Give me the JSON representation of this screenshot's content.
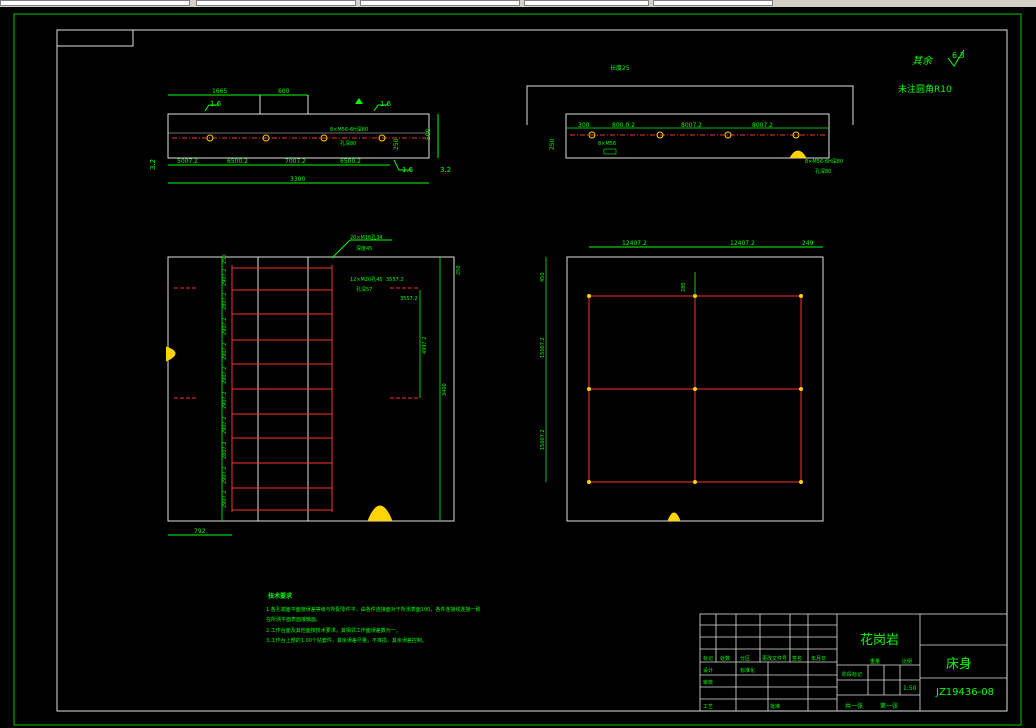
{
  "title_block": {
    "material": "花岗岩",
    "part_name": "床身",
    "drawing_number": "JZ19436-08",
    "scale": "1:50",
    "sheet_total": "共一张",
    "sheet_index": "第一张",
    "weight_label": "重量",
    "scale_label": "比例",
    "stage_label": "阶段标记",
    "process_label": "工艺",
    "approve_label": "批准",
    "design_label": "设计",
    "check_label": "审核",
    "standard_label": "标准化",
    "mark_label": "标记",
    "count_label": "处数",
    "zone_label": "分区",
    "change_doc_label": "更改文件号",
    "sign_label": "签名",
    "date_label": "年月日",
    "mark2_label": "标记"
  },
  "notes": {
    "heading": "技术要求",
    "lines": [
      "1.各孔端面平面度误差等级与所配零件平，由各件连接面对于所测表面100，各件连接线连接一致",
      "在所测平面表面接触面。",
      "2.工作台面及其他面按技术要求，其相邻工作面误差数为一。",
      "3.工作台上部的1.00个钻套件，其余误差尽量，不准损，其余误差控制。"
    ]
  },
  "roughness": {
    "label": "其余",
    "value": "6.3",
    "corner_note": "未注圆角R10"
  },
  "front_view": {
    "dims_top": [
      "1665",
      "600"
    ],
    "roughness_marks": [
      "1.6",
      "1.6"
    ],
    "hole_note": "8×M56-6H深80",
    "hole_note2": "孔深80",
    "dims_bottom": [
      "5007.2",
      "6500.2",
      "7007.2",
      "6500.2"
    ],
    "overall": "3300",
    "height": "500",
    "side_dim": "250",
    "rough_left": "3.2",
    "rough_right": "3.2",
    "rough_bottom": "1.6"
  },
  "side_view": {
    "top_note": "长度25",
    "dims": [
      "300",
      "800.0.2",
      "8007.2",
      "8007.2"
    ],
    "left_dim": "250",
    "note1": "8×M56",
    "note2": "8×M56-6H深80",
    "note3": "孔深80"
  },
  "top_view": {
    "callout1": "20×M16孔34",
    "callout1b": "深度45",
    "callout2": "12×M20孔45",
    "callout2b": "孔深57",
    "dim_a": "3557.2",
    "dim_b": "3557.2",
    "dim_right": "250",
    "dim_vert": "3400",
    "dim_vert2": "4997.2",
    "dim_bottom": "792",
    "left_dims": [
      "250",
      "2907.2",
      "2807.2",
      "2907.2",
      "2907.2",
      "2907.2",
      "2907.2",
      "2907.2",
      "2807.2",
      "2907.2",
      "2907.2",
      "2907.2",
      "2907.2"
    ]
  },
  "plan_view": {
    "dims_top": [
      "12407.2",
      "12407.2",
      "249"
    ],
    "dim_left_top": "450",
    "dim_left_mid": "15007.2",
    "dim_left_bot": "15007.2",
    "small_dim": "280"
  }
}
